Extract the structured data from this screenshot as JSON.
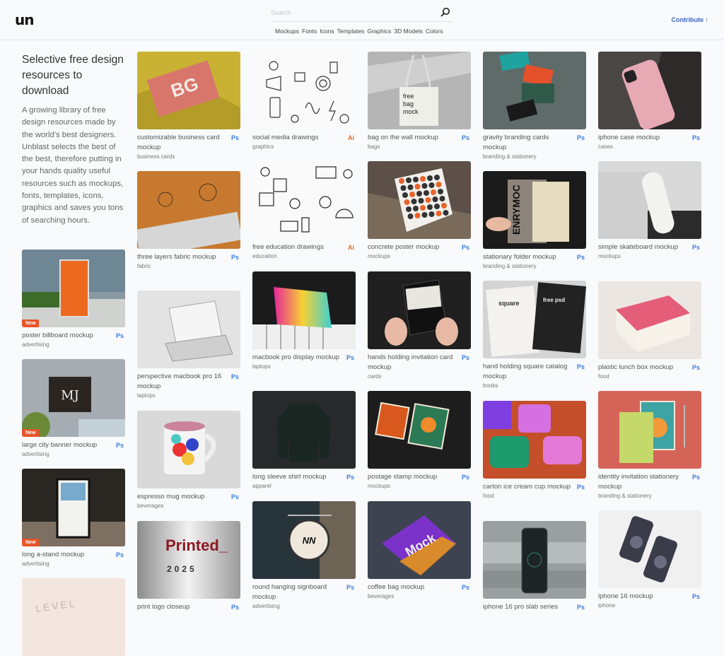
{
  "header": {
    "logo": "un",
    "search_placeholder": "Search",
    "nav": [
      "Mockups",
      "Fonts",
      "Icons",
      "Templates",
      "Graphics",
      "3D Models",
      "Colors"
    ],
    "contribute_label": "Contribute ↑"
  },
  "intro": {
    "heading": "Selective free design resources to download",
    "body": "A growing library of free design resources made by the world's best designers. Unblast selects the best of the best, therefore putting in your hands quality useful resources such as mockups, fonts, templates, icons, graphics and saves you tons of searching hours."
  },
  "colors": {
    "ps": "#3b7de0",
    "ai": "#e06a24",
    "new_badge": "#e8542a",
    "link": "#3b66c4"
  },
  "badge_new_label": "New",
  "columns": [
    [
      {
        "title": "poster billboard mockup",
        "category": "advertising",
        "tool": "Ps",
        "new": true,
        "icon": "billboard-image"
      },
      {
        "title": "large city banner mockup",
        "category": "advertising",
        "tool": "Ps",
        "new": true,
        "icon": "city-banner-image"
      },
      {
        "title": "long a-stand mockup",
        "category": "advertising",
        "tool": "Ps",
        "new": true,
        "icon": "a-stand-image"
      },
      {
        "title": "",
        "category": "",
        "tool": "",
        "new": false,
        "icon": "level-paper-image"
      }
    ],
    [
      {
        "title": "customizable business card mockup",
        "category": "business cards",
        "tool": "Ps",
        "icon": "business-card-image"
      },
      {
        "title": "three layers fabric mockup",
        "category": "fabric",
        "tool": "Ps",
        "icon": "fabric-image"
      },
      {
        "title": "perspective macbook pro 16 mockup",
        "category": "laptops",
        "tool": "Ps",
        "icon": "macbook-image"
      },
      {
        "title": "espresso mug mockup",
        "category": "beverages",
        "tool": "Ps",
        "icon": "mug-image"
      },
      {
        "title": "print logo closeup",
        "category": "",
        "tool": "Ps",
        "icon": "printed-logo-image",
        "thumb_text": "Printed_",
        "thumb_sub": "2025"
      }
    ],
    [
      {
        "title": "social media drawings",
        "category": "graphics",
        "tool": "Ai",
        "icon": "social-doodles-image"
      },
      {
        "title": "free education drawings",
        "category": "education",
        "tool": "Ai",
        "icon": "education-doodles-image"
      },
      {
        "title": "macbook pro display mockup",
        "category": "laptops",
        "tool": "Ps",
        "icon": "macbook-display-image"
      },
      {
        "title": "long sleeve shirt mockup",
        "category": "apparel",
        "tool": "Ps",
        "icon": "shirt-image"
      },
      {
        "title": "round hanging signboard mockup",
        "category": "advertising",
        "tool": "Ps",
        "icon": "signboard-image"
      }
    ],
    [
      {
        "title": "bag on the wall mockup",
        "category": "bags",
        "tool": "Ps",
        "icon": "tote-bag-image"
      },
      {
        "title": "concrete poster mockup",
        "category": "mockups",
        "tool": "Ps",
        "icon": "concrete-poster-image"
      },
      {
        "title": "hands holding invitation card mockup",
        "category": "cards",
        "tool": "Ps",
        "icon": "invitation-card-image"
      },
      {
        "title": "postage stamp mockup",
        "category": "mockups",
        "tool": "Ps",
        "icon": "stamp-image"
      },
      {
        "title": "coffee bag mockup",
        "category": "beverages",
        "tool": "Ps",
        "icon": "coffee-bag-image"
      }
    ],
    [
      {
        "title": "gravity branding cards mockup",
        "category": "branding & stationery",
        "tool": "Ps",
        "icon": "branding-cards-image"
      },
      {
        "title": "stationary folder mockup",
        "category": "branding & stationery",
        "tool": "Ps",
        "icon": "folder-image"
      },
      {
        "title": "hand holding square catalog mockup",
        "category": "books",
        "tool": "Ps",
        "icon": "catalog-image"
      },
      {
        "title": "carton ice cream cup mockup",
        "category": "food",
        "tool": "Ps",
        "icon": "ice-cream-image"
      },
      {
        "title": "iphone 16 pro slab series",
        "category": "",
        "tool": "Ps",
        "icon": "iphone-slab-image"
      }
    ],
    [
      {
        "title": "iphone case mockup",
        "category": "cases",
        "tool": "Ps",
        "icon": "iphone-case-image"
      },
      {
        "title": "simple skateboard mockup",
        "category": "mockups",
        "tool": "Ps",
        "icon": "skateboard-image"
      },
      {
        "title": "plastic lunch box mockup",
        "category": "food",
        "tool": "Ps",
        "icon": "lunch-box-image"
      },
      {
        "title": "identity invitation stationery mockup",
        "category": "branding & stationery",
        "tool": "Ps",
        "icon": "identity-invitation-image"
      },
      {
        "title": "iphone 16 mockup",
        "category": "iphone",
        "tool": "Ps",
        "icon": "iphone16-image"
      }
    ]
  ]
}
